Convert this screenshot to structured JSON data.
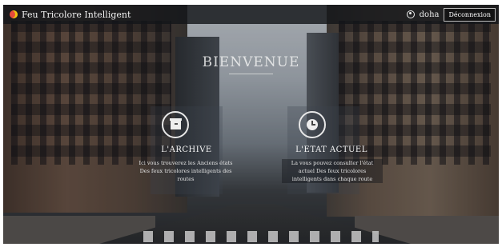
{
  "header": {
    "brand": "Feu Tricolore Intelligent",
    "username": "doha",
    "logout_label": "Déconnexion"
  },
  "hero": {
    "title": "BIENVENUE"
  },
  "cards": [
    {
      "icon": "archive-icon",
      "title": "L'ARCHIVE",
      "description": "Ici vous trouverez les Anciens états Des feux tricolores intelligents des routes"
    },
    {
      "icon": "clock-icon",
      "title": "L'ETAT ACTUEL",
      "description": "La vous pouvez consulter l'état actuel Des feux tricolores intelligents dans chaque route"
    }
  ]
}
